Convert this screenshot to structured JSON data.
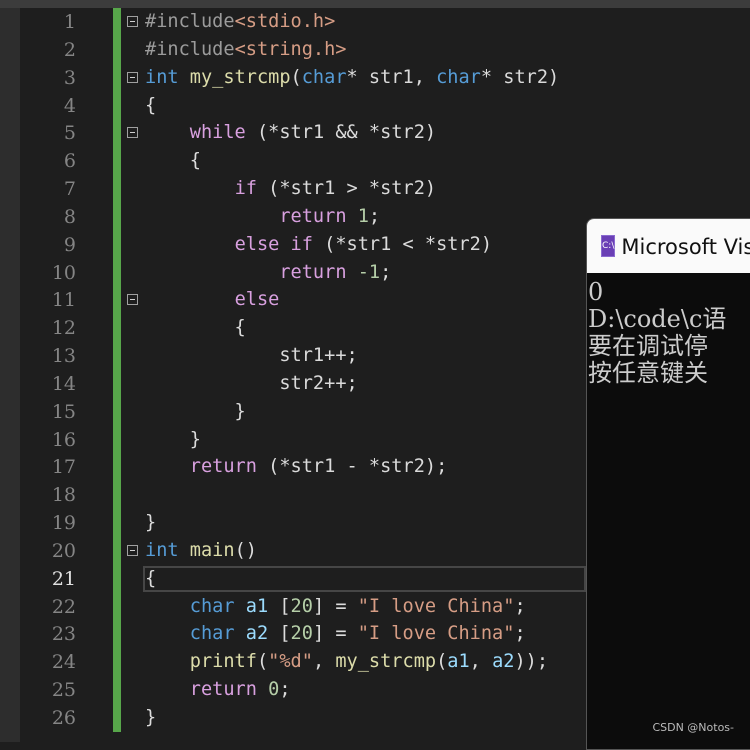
{
  "editor": {
    "current_line": 21,
    "lines": [
      [
        [
          "#include",
          "pp"
        ],
        [
          "<stdio.h>",
          "s"
        ]
      ],
      [
        [
          "#include",
          "pp"
        ],
        [
          "<string.h>",
          "s"
        ]
      ],
      [
        [
          "int ",
          "k"
        ],
        [
          "my_strcmp",
          "f"
        ],
        [
          "(",
          "d"
        ],
        [
          "char",
          "k"
        ],
        [
          "* ",
          "d"
        ],
        [
          "str1",
          "p"
        ],
        [
          ", ",
          "d"
        ],
        [
          "char",
          "k"
        ],
        [
          "* ",
          "d"
        ],
        [
          "str2",
          "p"
        ],
        [
          ")",
          "d"
        ]
      ],
      [
        [
          "{",
          "d"
        ]
      ],
      [
        [
          "    ",
          "d"
        ],
        [
          "while",
          "c"
        ],
        [
          " (*",
          "d"
        ],
        [
          "str1",
          "p"
        ],
        [
          " && *",
          "d"
        ],
        [
          "str2",
          "p"
        ],
        [
          ")",
          "d"
        ]
      ],
      [
        [
          "    {",
          "d"
        ]
      ],
      [
        [
          "        ",
          "d"
        ],
        [
          "if",
          "c"
        ],
        [
          " (*",
          "d"
        ],
        [
          "str1",
          "p"
        ],
        [
          " > *",
          "d"
        ],
        [
          "str2",
          "p"
        ],
        [
          ")",
          "d"
        ]
      ],
      [
        [
          "            ",
          "d"
        ],
        [
          "return",
          "c"
        ],
        [
          " ",
          "d"
        ],
        [
          "1",
          "n"
        ],
        [
          ";",
          "d"
        ]
      ],
      [
        [
          "        ",
          "d"
        ],
        [
          "else if",
          "c"
        ],
        [
          " (*",
          "d"
        ],
        [
          "str1",
          "p"
        ],
        [
          " < *",
          "d"
        ],
        [
          "str2",
          "p"
        ],
        [
          ")",
          "d"
        ]
      ],
      [
        [
          "            ",
          "d"
        ],
        [
          "return",
          "c"
        ],
        [
          " ",
          "d"
        ],
        [
          "-1",
          "n"
        ],
        [
          ";",
          "d"
        ]
      ],
      [
        [
          "        ",
          "d"
        ],
        [
          "else",
          "c"
        ]
      ],
      [
        [
          "        {",
          "d"
        ]
      ],
      [
        [
          "            ",
          "d"
        ],
        [
          "str1",
          "p"
        ],
        [
          "++;",
          "d"
        ]
      ],
      [
        [
          "            ",
          "d"
        ],
        [
          "str2",
          "p"
        ],
        [
          "++;",
          "d"
        ]
      ],
      [
        [
          "        }",
          "d"
        ]
      ],
      [
        [
          "    }",
          "d"
        ]
      ],
      [
        [
          "    ",
          "d"
        ],
        [
          "return",
          "c"
        ],
        [
          " (*",
          "d"
        ],
        [
          "str1",
          "p"
        ],
        [
          " - *",
          "d"
        ],
        [
          "str2",
          "p"
        ],
        [
          ");",
          "d"
        ]
      ],
      [],
      [
        [
          "}",
          "d"
        ]
      ],
      [
        [
          "int ",
          "k"
        ],
        [
          "main",
          "f"
        ],
        [
          "()",
          "d"
        ]
      ],
      [
        [
          "{",
          "d"
        ]
      ],
      [
        [
          "    ",
          "d"
        ],
        [
          "char ",
          "k"
        ],
        [
          "a1",
          "v"
        ],
        [
          " [",
          "d"
        ],
        [
          "20",
          "n"
        ],
        [
          "] = ",
          "d"
        ],
        [
          "\"I love China\"",
          "s"
        ],
        [
          ";",
          "d"
        ]
      ],
      [
        [
          "    ",
          "d"
        ],
        [
          "char ",
          "k"
        ],
        [
          "a2",
          "v"
        ],
        [
          " [",
          "d"
        ],
        [
          "20",
          "n"
        ],
        [
          "] = ",
          "d"
        ],
        [
          "\"I love China\"",
          "s"
        ],
        [
          ";",
          "d"
        ]
      ],
      [
        [
          "    ",
          "d"
        ],
        [
          "printf",
          "f"
        ],
        [
          "(",
          "d"
        ],
        [
          "\"%d\"",
          "s"
        ],
        [
          ", ",
          "d"
        ],
        [
          "my_strcmp",
          "f"
        ],
        [
          "(",
          "d"
        ],
        [
          "a1",
          "v"
        ],
        [
          ", ",
          "d"
        ],
        [
          "a2",
          "v"
        ],
        [
          "));",
          "d"
        ]
      ],
      [
        [
          "    ",
          "d"
        ],
        [
          "return",
          "c"
        ],
        [
          " ",
          "d"
        ],
        [
          "0",
          "n"
        ],
        [
          ";",
          "d"
        ]
      ],
      [
        [
          "}",
          "d"
        ]
      ]
    ],
    "fold_lines": [
      1,
      3,
      5,
      11,
      20
    ]
  },
  "console": {
    "title": "Microsoft Visual Studio 调试控制台",
    "icon": "console-app-icon",
    "icon_text": "C:\\",
    "output": [
      "0",
      "D:\\code\\c语",
      "要在调试停",
      "按任意键关"
    ]
  },
  "watermark": "CSDN @Notos-"
}
